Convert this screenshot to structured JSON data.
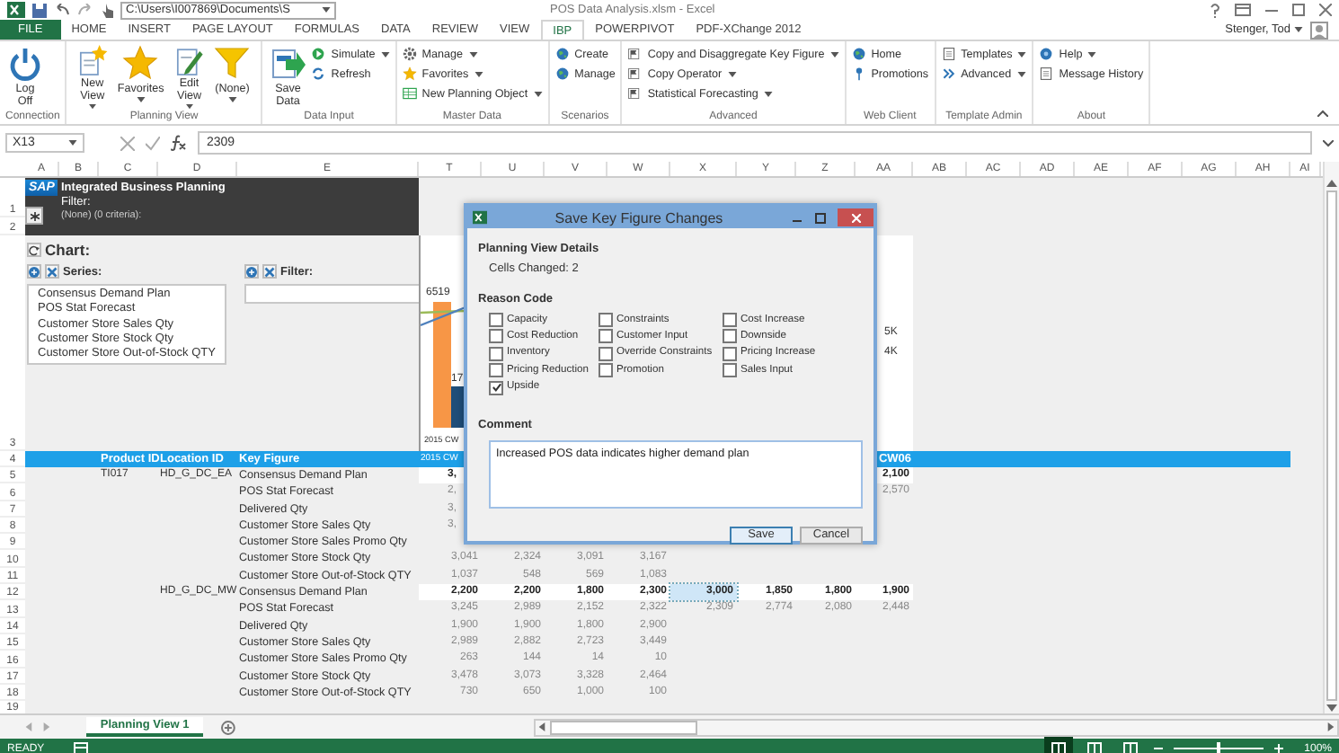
{
  "window": {
    "title": "POS Data Analysis.xlsm - Excel",
    "path": "C:\\Users\\I007869\\Documents\\S"
  },
  "tabs": [
    {
      "label": "FILE",
      "kind": "file",
      "selected": false
    },
    {
      "label": "HOME",
      "kind": "tab",
      "selected": false
    },
    {
      "label": "INSERT",
      "kind": "tab",
      "selected": false
    },
    {
      "label": "PAGE LAYOUT",
      "kind": "tab",
      "selected": false
    },
    {
      "label": "FORMULAS",
      "kind": "tab",
      "selected": false
    },
    {
      "label": "DATA",
      "kind": "tab",
      "selected": false
    },
    {
      "label": "REVIEW",
      "kind": "tab",
      "selected": false
    },
    {
      "label": "VIEW",
      "kind": "tab",
      "selected": false
    },
    {
      "label": "IBP",
      "kind": "tab",
      "selected": true
    },
    {
      "label": "POWERPIVOT",
      "kind": "tab",
      "selected": false
    },
    {
      "label": "PDF-XChange 2012",
      "kind": "tab",
      "selected": false
    }
  ],
  "user": "Stenger, Tod",
  "ribbon": [
    {
      "label": "Connection",
      "buttons": [
        {
          "label": "Log Off",
          "kind": "large",
          "dropdown": false
        }
      ]
    },
    {
      "label": "Planning View",
      "buttons": [
        {
          "label": "New View",
          "kind": "large",
          "dropdown": true
        },
        {
          "label": "Favorites",
          "kind": "large",
          "dropdown": true
        },
        {
          "label": "Edit View",
          "kind": "large",
          "dropdown": true
        },
        {
          "label": "(None)",
          "kind": "large",
          "dropdown": true
        }
      ]
    },
    {
      "label": "Data Input",
      "buttons": [
        {
          "label": "Save Data",
          "kind": "large",
          "dropdown": false
        },
        {
          "label": "Simulate",
          "kind": "small",
          "dropdown": true
        },
        {
          "label": "Refresh",
          "kind": "small",
          "dropdown": false
        }
      ]
    },
    {
      "label": "Master Data",
      "buttons": [
        {
          "label": "Manage",
          "kind": "small",
          "dropdown": true
        },
        {
          "label": "Favorites",
          "kind": "small",
          "dropdown": true
        },
        {
          "label": "New Planning Object",
          "kind": "small",
          "dropdown": true
        }
      ]
    },
    {
      "label": "Scenarios",
      "buttons": [
        {
          "label": "Create",
          "kind": "small",
          "dropdown": false
        },
        {
          "label": "Manage",
          "kind": "small",
          "dropdown": false
        }
      ]
    },
    {
      "label": "Advanced",
      "buttons": [
        {
          "label": "Copy and Disaggregate Key Figure",
          "kind": "small",
          "dropdown": true
        },
        {
          "label": "Copy Operator",
          "kind": "small",
          "dropdown": true
        },
        {
          "label": "Statistical Forecasting",
          "kind": "small",
          "dropdown": true
        }
      ]
    },
    {
      "label": "Web Client",
      "buttons": [
        {
          "label": "Home",
          "kind": "small",
          "dropdown": false
        },
        {
          "label": "Promotions",
          "kind": "small",
          "dropdown": false
        }
      ]
    },
    {
      "label": "Template Admin",
      "buttons": [
        {
          "label": "Templates",
          "kind": "small",
          "dropdown": true
        },
        {
          "label": "Advanced",
          "kind": "small",
          "dropdown": true
        }
      ]
    },
    {
      "label": "About",
      "buttons": [
        {
          "label": "Help",
          "kind": "small",
          "dropdown": true
        },
        {
          "label": "Message History",
          "kind": "small",
          "dropdown": false
        }
      ]
    }
  ],
  "formula_bar": {
    "name_box": "X13",
    "value": "2309"
  },
  "sheet": {
    "columns": [
      "A",
      "B",
      "C",
      "D",
      "E",
      "T",
      "U",
      "V",
      "W",
      "X",
      "Y",
      "Z",
      "AA",
      "AB",
      "AC",
      "AD",
      "AE",
      "AF",
      "AG",
      "AH",
      "AI"
    ],
    "row_numbers": [
      "1",
      "2",
      "3",
      "4",
      "5",
      "6",
      "7",
      "8",
      "9",
      "10",
      "11",
      "12",
      "13",
      "14",
      "15",
      "16",
      "17",
      "18",
      "19"
    ],
    "header_band": {
      "logo": "SAP",
      "title": "Integrated Business Planning",
      "filter_label": "Filter:",
      "filter_value": "(None) (0 criteria):"
    },
    "chart_panel": {
      "title": "Chart:",
      "series_label": "Series:",
      "series": [
        "Consensus Demand Plan",
        "POS Stat Forecast",
        "Customer Store Sales Qty",
        "Customer Store Stock Qty",
        "Customer Store Out-of-Stock QTY"
      ],
      "filter_label": "Filter:"
    },
    "chart_fragments": {
      "bar_labels": [
        "6519",
        "17"
      ],
      "x_label": "2015 CW",
      "axis_labels": [
        "5K",
        "4K"
      ]
    },
    "table_header": {
      "product": "Product ID",
      "location": "Location ID",
      "key_figure": "Key Figure",
      "first_week": "2015 CW",
      "last_week": "CW06"
    },
    "rows": [
      {
        "product": "TI017",
        "location": "HD_G_DC_EA",
        "key_figure": "Consensus Demand Plan",
        "editable": true,
        "cut_value": "3,",
        "last_week_value": "2,100"
      },
      {
        "key_figure": "POS Stat Forecast",
        "editable": false,
        "cut_value": "2,",
        "last_week_value": "2,570"
      },
      {
        "key_figure": "Delivered Qty",
        "editable": false,
        "cut_value": "3,"
      },
      {
        "key_figure": "Customer Store Sales Qty",
        "editable": false,
        "cut_value": "3,"
      },
      {
        "key_figure": "Customer Store Sales Promo Qty",
        "editable": false
      },
      {
        "key_figure": "Customer Store Stock Qty",
        "editable": false,
        "values": [
          {
            "text": "3,041",
            "selected": false
          },
          {
            "text": "2,324",
            "selected": false
          },
          {
            "text": "3,091",
            "selected": false
          },
          {
            "text": "3,167",
            "selected": false
          }
        ]
      },
      {
        "key_figure": "Customer Store Out-of-Stock QTY",
        "editable": false,
        "values": [
          {
            "text": "1,037",
            "selected": false
          },
          {
            "text": "548",
            "selected": false
          },
          {
            "text": "569",
            "selected": false
          },
          {
            "text": "1,083",
            "selected": false
          }
        ]
      },
      {
        "location": "HD_G_DC_MW",
        "key_figure": "Consensus Demand Plan",
        "editable": true,
        "values": [
          {
            "text": "2,200",
            "selected": false
          },
          {
            "text": "2,200",
            "selected": false
          },
          {
            "text": "1,800",
            "selected": false
          },
          {
            "text": "2,300",
            "selected": false
          },
          {
            "text": "3,000",
            "selected": true
          },
          {
            "text": "1,850",
            "selected": false
          },
          {
            "text": "1,800",
            "selected": false
          },
          {
            "text": "1,900",
            "selected": false
          }
        ]
      },
      {
        "key_figure": "POS Stat Forecast",
        "editable": false,
        "values": [
          {
            "text": "3,245",
            "selected": false
          },
          {
            "text": "2,989",
            "selected": false
          },
          {
            "text": "2,152",
            "selected": false
          },
          {
            "text": "2,322",
            "selected": false
          },
          {
            "text": "2,309",
            "selected": false
          },
          {
            "text": "2,774",
            "selected": false
          },
          {
            "text": "2,080",
            "selected": false
          },
          {
            "text": "2,448",
            "selected": false
          }
        ]
      },
      {
        "key_figure": "Delivered Qty",
        "editable": false,
        "values": [
          {
            "text": "1,900",
            "selected": false
          },
          {
            "text": "1,900",
            "selected": false
          },
          {
            "text": "1,800",
            "selected": false
          },
          {
            "text": "2,900",
            "selected": false
          }
        ]
      },
      {
        "key_figure": "Customer Store Sales Qty",
        "editable": false,
        "values": [
          {
            "text": "2,989",
            "selected": false
          },
          {
            "text": "2,882",
            "selected": false
          },
          {
            "text": "2,723",
            "selected": false
          },
          {
            "text": "3,449",
            "selected": false
          }
        ]
      },
      {
        "key_figure": "Customer Store Sales Promo Qty",
        "editable": false,
        "values": [
          {
            "text": "263",
            "selected": false
          },
          {
            "text": "144",
            "selected": false
          },
          {
            "text": "14",
            "selected": false
          },
          {
            "text": "10",
            "selected": false
          }
        ]
      },
      {
        "key_figure": "Customer Store Stock Qty",
        "editable": false,
        "values": [
          {
            "text": "3,478",
            "selected": false
          },
          {
            "text": "3,073",
            "selected": false
          },
          {
            "text": "3,328",
            "selected": false
          },
          {
            "text": "2,464",
            "selected": false
          }
        ]
      },
      {
        "key_figure": "Customer Store Out-of-Stock QTY",
        "editable": false,
        "values": [
          {
            "text": "730",
            "selected": false
          },
          {
            "text": "650",
            "selected": false
          },
          {
            "text": "1,000",
            "selected": false
          },
          {
            "text": "100",
            "selected": false
          }
        ]
      }
    ]
  },
  "dialog": {
    "title": "Save Key Figure Changes",
    "details_heading": "Planning View Details",
    "cells_changed": "Cells Changed: 2",
    "reason_heading": "Reason Code",
    "reason_columns": [
      [
        {
          "label": "Capacity",
          "checked": false
        },
        {
          "label": "Cost Reduction",
          "checked": false
        },
        {
          "label": "Inventory",
          "checked": false
        },
        {
          "label": "Pricing Reduction",
          "checked": false
        },
        {
          "label": "Upside",
          "checked": true
        }
      ],
      [
        {
          "label": "Constraints",
          "checked": false
        },
        {
          "label": "Customer Input",
          "checked": false
        },
        {
          "label": "Override Constraints",
          "checked": false
        },
        {
          "label": "Promotion",
          "checked": false
        }
      ],
      [
        {
          "label": "Cost Increase",
          "checked": false
        },
        {
          "label": "Downside",
          "checked": false
        },
        {
          "label": "Pricing Increase",
          "checked": false
        },
        {
          "label": "Sales Input",
          "checked": false
        }
      ]
    ],
    "comment_heading": "Comment",
    "comment": "Increased POS data indicates higher demand plan",
    "buttons": [
      {
        "label": "Save",
        "kind": "default"
      },
      {
        "label": "Cancel",
        "kind": "normal"
      }
    ]
  },
  "sheet_tabs": [
    {
      "label": "Planning View 1",
      "selected": true
    }
  ],
  "status_bar": {
    "mode": "READY",
    "views": [
      {
        "selected": true
      },
      {
        "selected": false
      },
      {
        "selected": false
      }
    ],
    "zoom_slider": {
      "level": 0.5
    },
    "zoom": "100%"
  }
}
